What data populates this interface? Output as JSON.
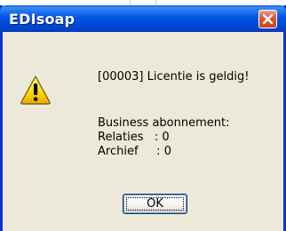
{
  "dialog": {
    "title": "EDIsoap",
    "close_icon": "close-icon",
    "warning_icon": "warning-icon",
    "message_line1": "[00003] Licentie is geldig!",
    "message_line2": "Business abonnement:",
    "message_line3": "Relaties   : 0",
    "message_line4": "Archief     : 0",
    "ok_label": "OK"
  },
  "colors": {
    "titlebar": "#0055e5",
    "frame": "#0831d9",
    "body": "#ece9d8",
    "close_button": "#e05a38"
  }
}
